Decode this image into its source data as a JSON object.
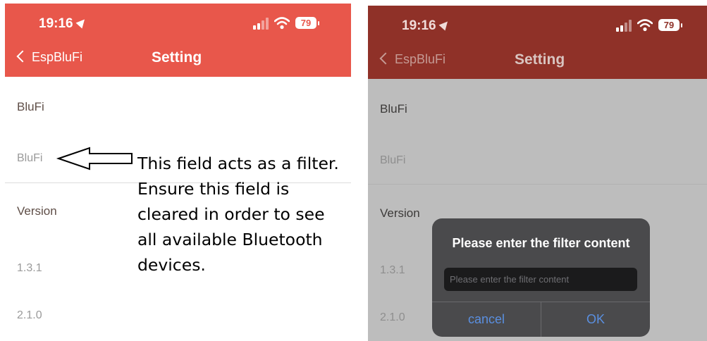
{
  "status_bar": {
    "time": "19:16",
    "battery": "79"
  },
  "nav": {
    "back_label": "EspBluFi",
    "title": "Setting"
  },
  "settings": {
    "blufi_header": "BluFi",
    "blufi_value": "BluFi",
    "version_header": "Version",
    "version_1": "1.3.1",
    "version_2": "2.1.0"
  },
  "annotation": {
    "text": "This field acts as a filter. Ensure this field is cleared in order to see all available Bluetooth devices."
  },
  "dialog": {
    "title": "Please enter the filter content",
    "input_placeholder": "Please enter the filter content",
    "input_value": "",
    "cancel_label": "cancel",
    "ok_label": "OK"
  },
  "colors": {
    "navbar": "#e8574b",
    "navbar_dimmed": "#8f3128",
    "dialog_background": "#4a4a4c",
    "dialog_button": "#5a8fe0"
  },
  "icons": [
    "location-arrow-icon",
    "cellular-signal-icon",
    "wifi-icon",
    "battery-icon",
    "chevron-left-icon",
    "arrow-pointer-icon"
  ]
}
